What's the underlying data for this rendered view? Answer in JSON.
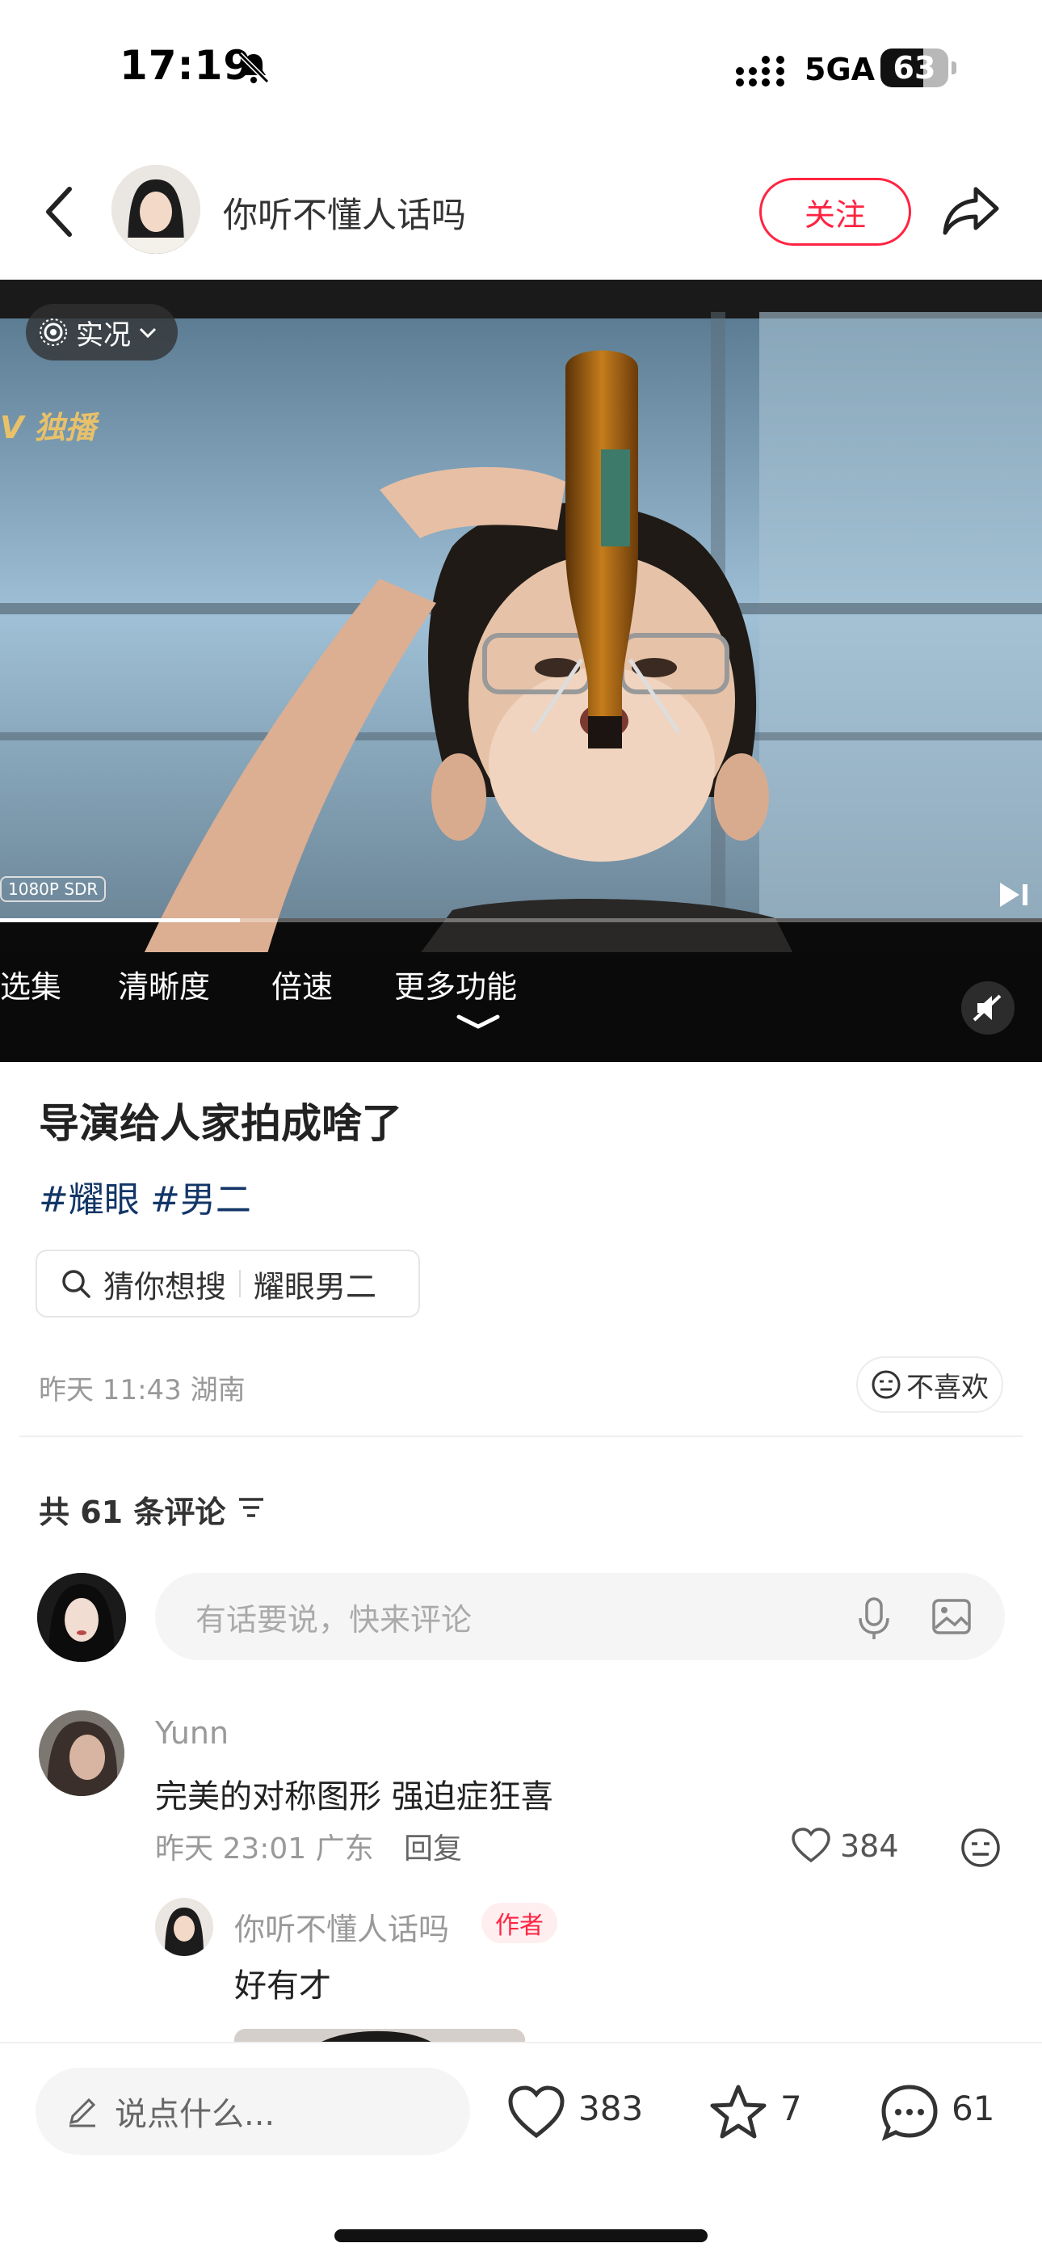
{
  "status_bar": {
    "time": "17:19",
    "network": "5GA",
    "battery": "63",
    "battery_level": 0.63
  },
  "header": {
    "author_name": "你听不懂人话吗",
    "follow_label": "关注"
  },
  "video": {
    "live_label": "实况",
    "watermark": "V 独播",
    "resolution": "1080P SDR",
    "progress": 0.23,
    "controls": [
      "选集",
      "清晰度",
      "倍速",
      "更多功能"
    ]
  },
  "post": {
    "title": "导演给人家拍成啥了",
    "tags": [
      "#耀眼",
      "#男二"
    ],
    "search_hint": "猜你想搜",
    "search_keyword": "耀眼男二",
    "meta": "昨天 11:43 湖南",
    "dislike_label": "不喜欢"
  },
  "comments": {
    "count_label": "共 61 条评论",
    "input_placeholder": "有话要说，快来评论",
    "items": [
      {
        "user": "Yunn",
        "text": "完美的对称图形 强迫症狂喜",
        "meta": "昨天 23:01 广东",
        "reply_label": "回复",
        "likes": "384",
        "reply": {
          "user": "你听不懂人话吗",
          "badge": "作者",
          "text": "好有才"
        }
      }
    ]
  },
  "bottom_bar": {
    "say_placeholder": "说点什么...",
    "likes": "383",
    "stars": "7",
    "comments": "61"
  },
  "colors": {
    "accent": "#ff2442",
    "tag": "#133667",
    "muted": "#999999"
  }
}
